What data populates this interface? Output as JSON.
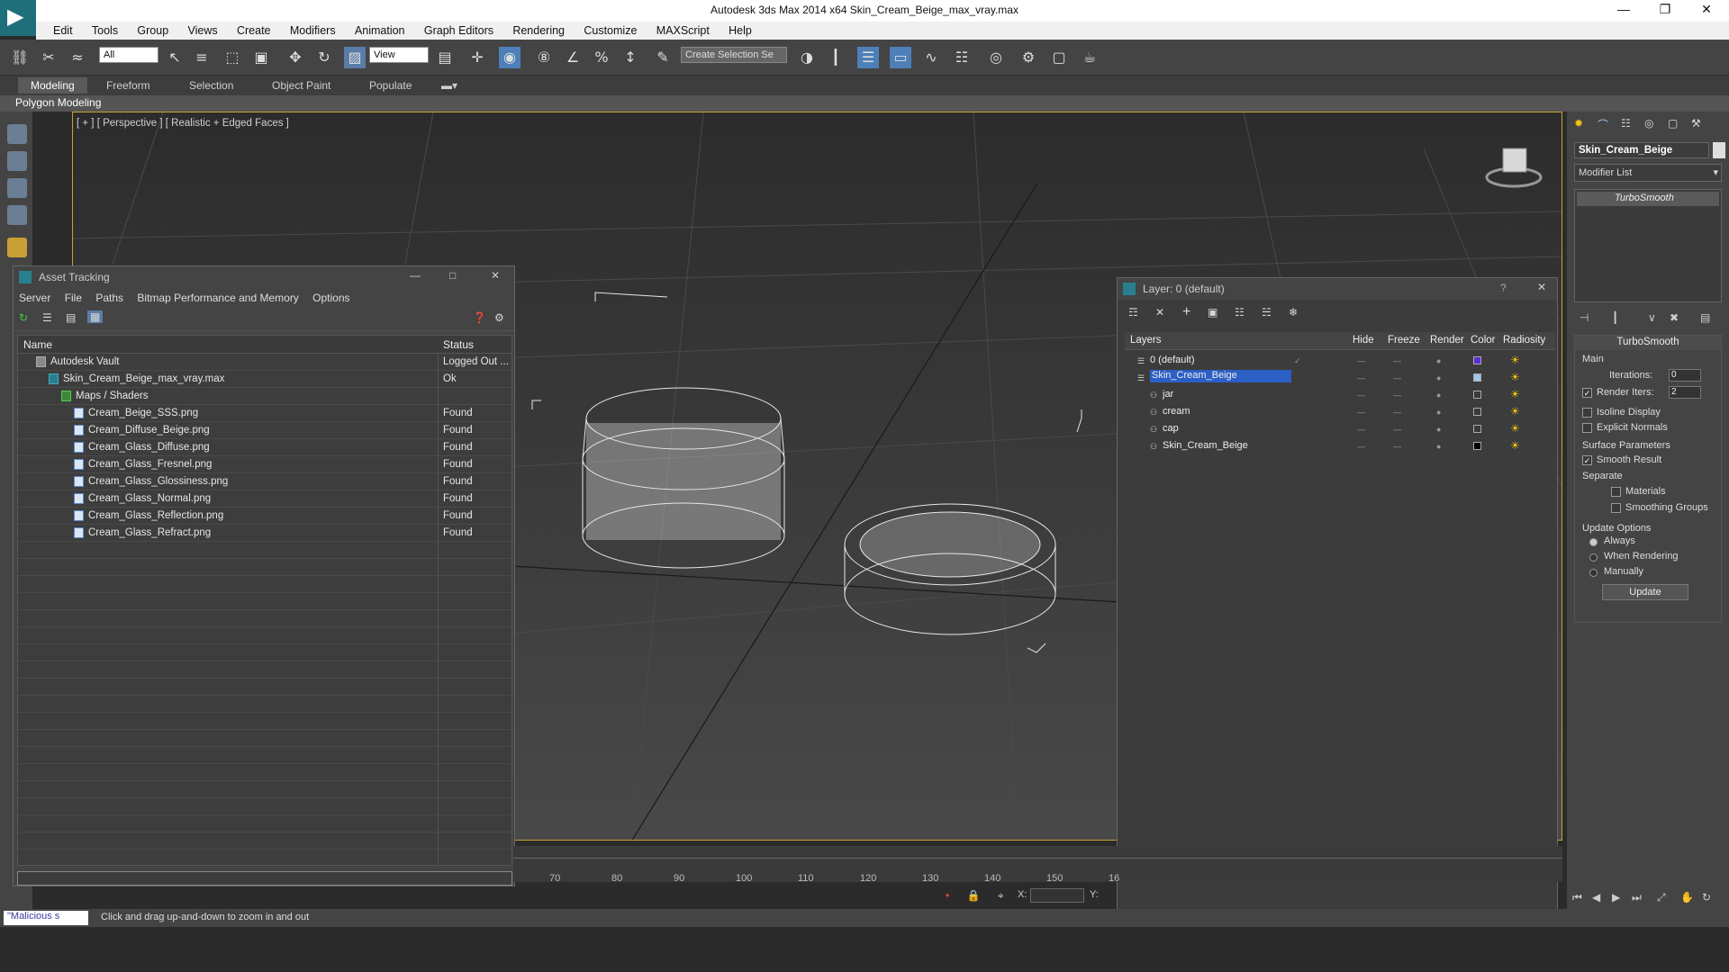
{
  "window": {
    "title": "Autodesk 3ds Max  2014 x64     Skin_Cream_Beige_max_vray.max"
  },
  "menubar": [
    "Edit",
    "Tools",
    "Group",
    "Views",
    "Create",
    "Modifiers",
    "Animation",
    "Graph Editors",
    "Rendering",
    "Customize",
    "MAXScript",
    "Help"
  ],
  "toolbar": {
    "selection_filter": "All",
    "ref_coord": "View",
    "selection_set_placeholder": "Create Selection Se"
  },
  "ribbon": {
    "tabs": [
      "Modeling",
      "Freeform",
      "Selection",
      "Object Paint",
      "Populate"
    ],
    "active_tab": "Modeling",
    "sub_label": "Polygon Modeling"
  },
  "viewport": {
    "label": "[ + ] [ Perspective ] [ Realistic + Edged Faces ]"
  },
  "timeline": {
    "ticks": [
      "70",
      "80",
      "90",
      "100",
      "110",
      "120",
      "130",
      "140",
      "150",
      "16"
    ]
  },
  "coords": {
    "x_label": "X:",
    "y_label": "Y:"
  },
  "statusbar": {
    "macro_text": "\"Malicious s",
    "message": "Click and drag up-and-down to zoom in and out"
  },
  "asset_tracking": {
    "title": "Asset Tracking",
    "menu": [
      "Server",
      "File",
      "Paths",
      "Bitmap Performance and Memory",
      "Options"
    ],
    "columns": {
      "name": "Name",
      "status": "Status"
    },
    "rows": [
      {
        "name": "Autodesk Vault",
        "status": "Logged Out ...",
        "level": 0
      },
      {
        "name": "Skin_Cream_Beige_max_vray.max",
        "status": "Ok",
        "level": 1
      },
      {
        "name": "Maps / Shaders",
        "status": "",
        "level": 2
      },
      {
        "name": "Cream_Beige_SSS.png",
        "status": "Found",
        "level": 3
      },
      {
        "name": "Cream_Diffuse_Beige.png",
        "status": "Found",
        "level": 3
      },
      {
        "name": "Cream_Glass_Diffuse.png",
        "status": "Found",
        "level": 3
      },
      {
        "name": "Cream_Glass_Fresnel.png",
        "status": "Found",
        "level": 3
      },
      {
        "name": "Cream_Glass_Glossiness.png",
        "status": "Found",
        "level": 3
      },
      {
        "name": "Cream_Glass_Normal.png",
        "status": "Found",
        "level": 3
      },
      {
        "name": "Cream_Glass_Reflection.png",
        "status": "Found",
        "level": 3
      },
      {
        "name": "Cream_Glass_Refract.png",
        "status": "Found",
        "level": 3
      }
    ]
  },
  "layer_window": {
    "title": "Layer: 0 (default)",
    "help": "?",
    "columns": [
      "Layers",
      "Hide",
      "Freeze",
      "Render",
      "Color",
      "Radiosity"
    ],
    "rows": [
      {
        "name": "0 (default)",
        "color": "#5a2ed8",
        "indent": 0,
        "selected": false
      },
      {
        "name": "Skin_Cream_Beige",
        "color": "#9ec6ee",
        "indent": 0,
        "selected": true
      },
      {
        "name": "jar",
        "color": "#3a3a3a",
        "indent": 1,
        "selected": false
      },
      {
        "name": "cream",
        "color": "#3a3a3a",
        "indent": 1,
        "selected": false
      },
      {
        "name": "cap",
        "color": "#3a3a3a",
        "indent": 1,
        "selected": false
      },
      {
        "name": "Skin_Cream_Beige",
        "color": "#000000",
        "indent": 1,
        "selected": false
      }
    ]
  },
  "command_panel": {
    "object_name": "Skin_Cream_Beige",
    "modifier_list": "Modifier List",
    "stack_item": "TurboSmooth",
    "rollout_title": "TurboSmooth",
    "main_label": "Main",
    "iterations_label": "Iterations:",
    "iterations_value": "0",
    "render_iters_label": "Render Iters:",
    "render_iters_value": "2",
    "isoline_label": "Isoline Display",
    "explicit_normals_label": "Explicit Normals",
    "surface_params_label": "Surface Parameters",
    "smooth_result_label": "Smooth Result",
    "separate_label": "Separate",
    "materials_label": "Materials",
    "smoothing_groups_label": "Smoothing Groups",
    "update_options_label": "Update Options",
    "always_label": "Always",
    "when_rendering_label": "When Rendering",
    "manually_label": "Manually",
    "update_button": "Update"
  }
}
